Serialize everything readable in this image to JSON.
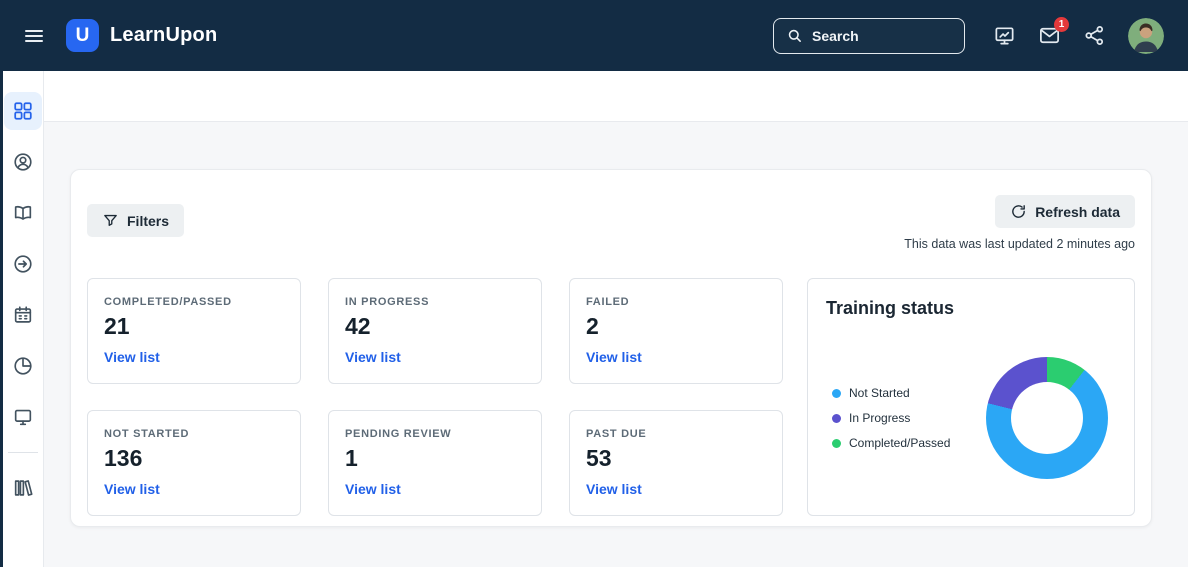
{
  "navbar": {
    "brand": "LearnUpon",
    "search": {
      "placeholder": "Search"
    },
    "mail_badge": "1"
  },
  "sidebar": {
    "items": [
      {
        "icon": "dashboard-grid-icon",
        "active": true
      },
      {
        "icon": "users-icon",
        "active": false
      },
      {
        "icon": "courses-book-icon",
        "active": false
      },
      {
        "icon": "enrollments-icon",
        "active": false
      },
      {
        "icon": "sessions-calendar-icon",
        "active": false
      },
      {
        "icon": "reports-pie-icon",
        "active": false
      },
      {
        "icon": "screen-icon",
        "active": false
      },
      {
        "icon": "catalog-library-icon",
        "active": false
      }
    ]
  },
  "main": {
    "filters_label": "Filters",
    "refresh_label": "Refresh data",
    "last_updated": "This data was last updated 2 minutes ago",
    "stats": [
      {
        "label": "COMPLETED/PASSED",
        "value": "21",
        "link_label": "View list"
      },
      {
        "label": "IN PROGRESS",
        "value": "42",
        "link_label": "View list"
      },
      {
        "label": "FAILED",
        "value": "2",
        "link_label": "View list"
      },
      {
        "label": "NOT STARTED",
        "value": "136",
        "link_label": "View list"
      },
      {
        "label": "PENDING REVIEW",
        "value": "1",
        "link_label": "View list"
      },
      {
        "label": "PAST DUE",
        "value": "53",
        "link_label": "View list"
      }
    ],
    "training_status": {
      "title": "Training status",
      "chart_data": {
        "type": "pie",
        "donut": true,
        "legend_position": "left",
        "labels": [
          "Not Started",
          "In Progress",
          "Completed/Passed"
        ],
        "values": [
          136,
          42,
          21
        ],
        "colors": [
          "#2ba7f5",
          "#5b52ce",
          "#2bcd70"
        ]
      }
    }
  },
  "colors": {
    "navbar_bg": "#132c44",
    "accent_blue": "#2160e8",
    "active_sidebar_bg": "#e7f1fd",
    "badge_red": "#e4393b"
  }
}
